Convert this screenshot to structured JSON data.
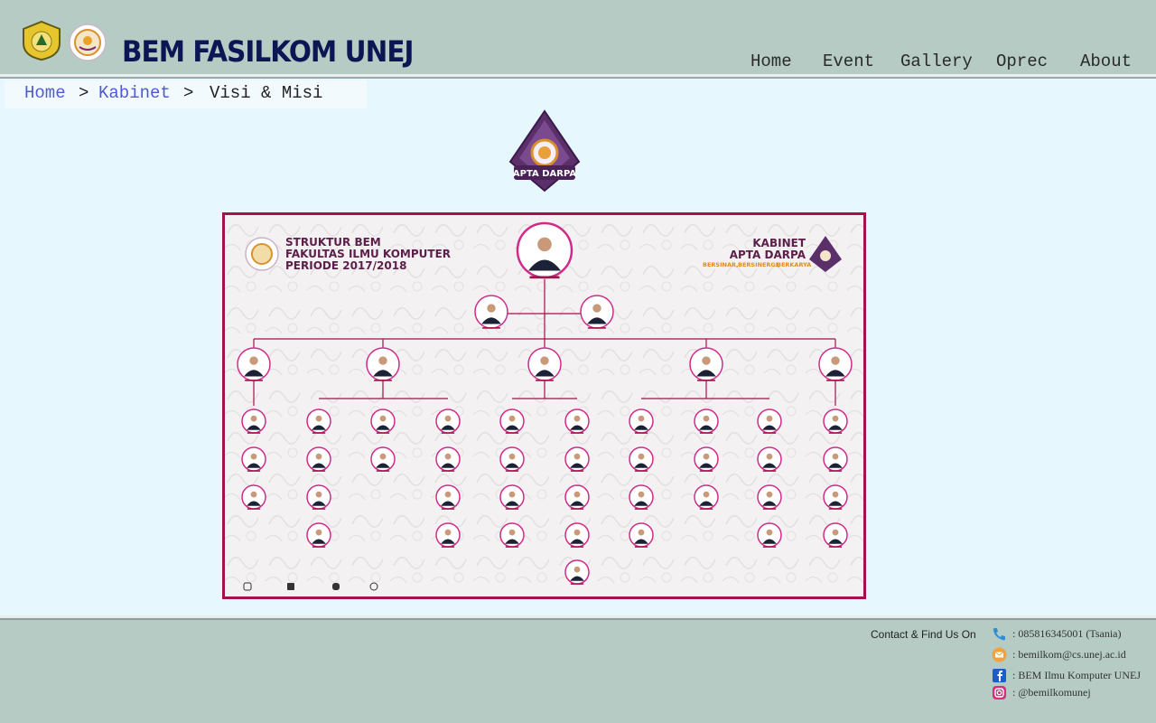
{
  "header": {
    "site_title": "BEM FASILKOM UNEJ",
    "nav": [
      "Home",
      "Event",
      "Gallery",
      "Oprec",
      "About"
    ]
  },
  "breadcrumb": {
    "items": [
      "Home",
      "Kabinet",
      "Visi & Misi"
    ],
    "separator": ">"
  },
  "emblem": {
    "label": "APTA DARPA"
  },
  "org_chart": {
    "title_lines": [
      "STRUKTUR BEM",
      "FAKULTAS ILMU KOMPUTER",
      "PERIODE 2017/2018"
    ],
    "cabinet_label": "KABINET",
    "cabinet_name": "APTA DARPA",
    "tagline": [
      "BERSINAR,",
      "BERSINERGI,",
      "BERKARYA"
    ]
  },
  "footer": {
    "contact_heading": "Contact & Find Us On",
    "contacts": [
      {
        "icon": "phone-icon",
        "text": ": 085816345001 (Tsania)"
      },
      {
        "icon": "email-icon",
        "text": ": bemilkom@cs.unej.ac.id"
      },
      {
        "icon": "facebook-icon",
        "text": ": BEM Ilmu Komputer UNEJ"
      },
      {
        "icon": "instagram-icon",
        "text": ": @bemilkomunej"
      }
    ]
  },
  "colors": {
    "header_bg": "#b5cbc3",
    "page_bg": "#e6f7fd",
    "title_color": "#0b1654",
    "link_color": "#5059d6",
    "chart_accent": "#a3124a"
  }
}
